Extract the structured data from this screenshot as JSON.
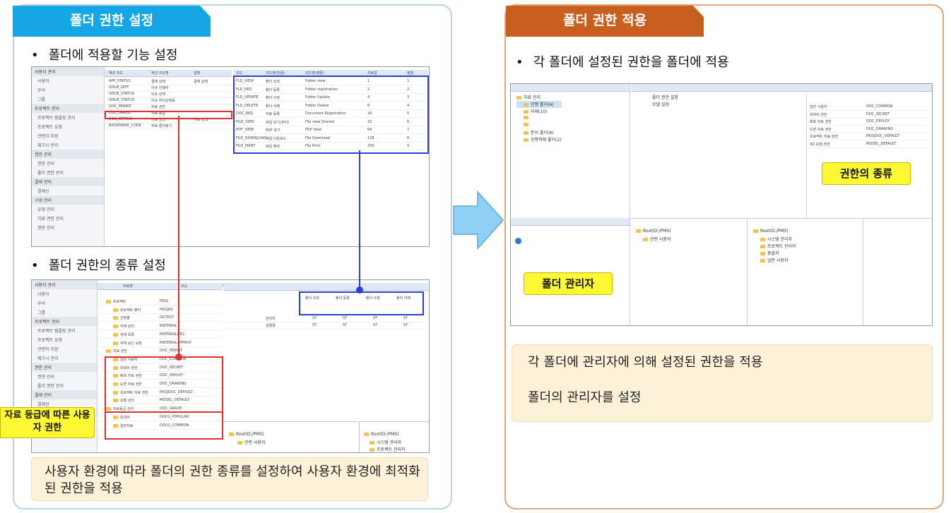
{
  "left": {
    "tab_title": "폴더 권한 설정",
    "bullet1": "폴더에 적용할 기능 설정",
    "bullet2": "폴더 권한의 종류 설정",
    "note": "사용자 환경에 따라 폴더의 권한 종류를 설정하여 사용자 환경에 최적화된 권한을 적용",
    "callout": "자료 등급에 따른 사용자 권한"
  },
  "right": {
    "tab_title": "폴더 권한 적용",
    "bullet1": "각 폴더에 설정된 권한을 폴더에 적용",
    "label_kinds": "권한의 종류",
    "label_admin": "폴더 관리자",
    "note_line1": "각 폴더에 관리자에 의해 설정된 권한을 적용",
    "note_line2": "폴더의 관리자를 설정"
  },
  "colors": {
    "blue_tab": "#16a6e6",
    "orange_tab": "#c95f1e",
    "arrow": "#8fd0f4",
    "highlight_red": "#e03131",
    "highlight_blue": "#2b3fd6",
    "note_bg": "#fdf2d8",
    "label_yellow": "#fef733"
  },
  "shot1": {
    "sidebar": [
      "사용자 관리",
      "사용자",
      "부서",
      "그룹",
      "프로젝트 관리",
      "프로젝트 템플릿 관리",
      "프로젝트 유형",
      "관련자 지정",
      "체크시 관리",
      "권한 관리",
      "권한 관리",
      "폴더 권한 관리",
      "결재 관리",
      "결재선",
      "구성 관리",
      "유형 관리",
      "자료 권한 관리",
      "권한 관리"
    ],
    "left_headers": [
      "액션 코드",
      "액션 코드명",
      "설명"
    ],
    "left_rows": [
      [
        "APP_STATUS",
        "결재 상태",
        "결재 상태"
      ],
      [
        "ISSUE_DIFF",
        "이슈 진행자",
        ""
      ],
      [
        "ISSUE_STATUS",
        "이슈 상태",
        ""
      ],
      [
        "ISSUE_STATUS",
        "이슈 처리상태등",
        ""
      ],
      [
        "DOC_PERMIT",
        "자료 권한",
        ""
      ],
      [
        "DOC_GRADE",
        "자료 등급",
        ""
      ],
      [
        "DOC_STATUS",
        "자료 상태",
        "자료 상태"
      ],
      [
        "BOOKMARK_CODE",
        "자료 즐겨찾기",
        ""
      ]
    ],
    "right_headers": [
      "코드",
      "코드명(한글)",
      "코드명(영문)",
      "자료값",
      "정렬"
    ],
    "right_rows": [
      [
        "FLD_VIEW",
        "폴더 조회",
        "Folder view",
        "1",
        "1"
      ],
      [
        "FLD_REG",
        "폴더 등록",
        "Folder registration",
        "2",
        "2"
      ],
      [
        "FLD_UPDATE",
        "폴더 수정",
        "Folder Update",
        "4",
        "3"
      ],
      [
        "FLD_DELETE",
        "폴더 삭제",
        "Folder Delete",
        "8",
        "4"
      ],
      [
        "DOC_REG",
        "자료 등록",
        "Document Registration",
        "16",
        "5"
      ],
      [
        "FILE_VIEW",
        "파일 보기(뷰어)",
        "File view Shared",
        "32",
        "6"
      ],
      [
        "PDF_VIEW",
        "PDF 보기",
        "PDF View",
        "64",
        "7"
      ],
      [
        "FILE_DOWNLOAD",
        "파일 다운로드",
        "File Download",
        "128",
        "8"
      ],
      [
        "FILE_PRINT",
        "파일 출력",
        "File Print",
        "256",
        "9"
      ]
    ]
  },
  "shot2": {
    "sidebar": [
      "사용자 관리",
      "사용자",
      "부서",
      "그룹",
      "프로젝트 관리",
      "프로젝트 템플릿 관리",
      "프로젝트 유형",
      "관련자 지정",
      "체크시 관리",
      "권한 관리",
      "권한 관리",
      "폴더 권한 관리",
      "결재 관리",
      "결재선",
      "구성 관리",
      "유형 관리",
      "자료 권한 관리"
    ],
    "tree_header": [
      "자료명",
      "코드",
      "하위 값"
    ],
    "tree_rows": [
      [
        "프로젝트",
        "PROJ"
      ],
      [
        "프로젝트 폴더",
        "PROJAS"
      ],
      [
        "산출물",
        "OUTPUT"
      ],
      [
        "자재 관리",
        "MATERIAL"
      ],
      [
        "자재 목록",
        "MATERIALREG"
      ],
      [
        "자재 승인 요청",
        "MATERIALAPPROV"
      ],
      [
        "자료 권한",
        "DOC_PERMIT"
      ],
      [
        "일반 사용자",
        "DOC_COMMON"
      ],
      [
        "대외비 권한",
        "DOC_SECRET"
      ],
      [
        "배포 자료 권한",
        "DOC_DEPLOY"
      ],
      [
        "도면 자료 권한",
        "DOC_DRAWING"
      ],
      [
        "프로젝트 자료 권한",
        "PROJDOC_DEFAULT"
      ],
      [
        "모델 관리",
        "MODEL_DEFAULT"
      ],
      [
        "자료등급 관리",
        "DOC_GRADE"
      ],
      [
        "대내비",
        "DOCG_POPULAR"
      ],
      [
        "일반자료",
        "DOCG_COMMON"
      ]
    ],
    "perm_headers": [
      "폴더 조회",
      "폴더 등록",
      "폴더 수정",
      "폴더 삭제"
    ],
    "perm_rows": [
      [
        "관리자",
        "ST",
        "ST",
        "ST",
        "ST"
      ],
      [
        "김철용",
        "ST",
        "ST",
        "ST",
        "ST"
      ]
    ]
  },
  "shot3": {
    "tree": [
      "자료 관리",
      "진행 폴더(A)",
      "자재(10)",
      "",
      "",
      "문서 폴더(A)",
      "진행객체 폴더(2)"
    ],
    "mid_rows": [
      "폴더 권한 설정",
      "모델 설정"
    ],
    "right_rows": [
      [
        "일반 사용자",
        "DOC_COMMON"
      ],
      [
        "대외비 권한",
        "DOC_SECRET"
      ],
      [
        "배포 자료 권한",
        "DOC_DEPLOY"
      ],
      [
        "도면 자료 권한",
        "DOC_DRAWING"
      ],
      [
        "프로젝트 자료 권한",
        "PROJDOC_DEFAULT"
      ],
      [
        "3D 모델 권한",
        "MODEL_DEFAULT"
      ]
    ],
    "bottom_trees": [
      [
        "Root(D:/PMS)",
        "관련 사용자"
      ],
      [
        "Root(D:/PMS)",
        "시스템 관리자",
        "프로젝트 관리자",
        "총괄자",
        "일반 사용자"
      ]
    ]
  }
}
